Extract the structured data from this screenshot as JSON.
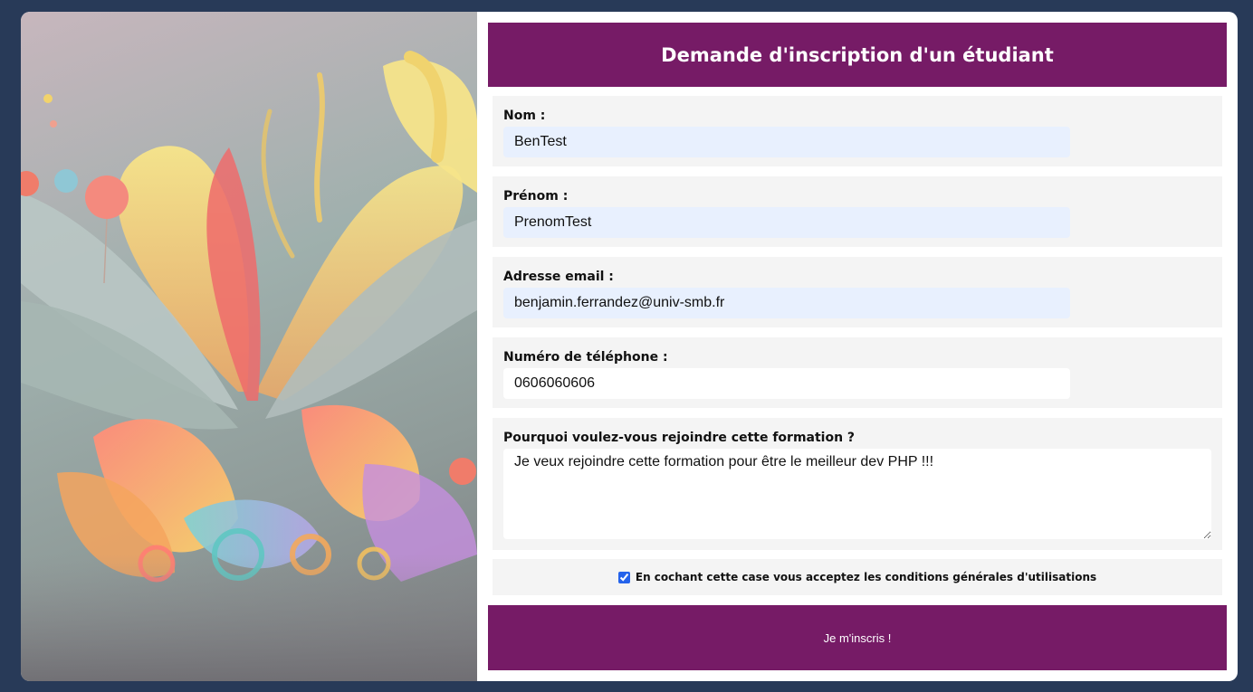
{
  "form": {
    "title": "Demande d'inscription d'un étudiant",
    "fields": [
      {
        "label": "Nom :",
        "value": "BenTest"
      },
      {
        "label": "Prénom :",
        "value": "PrenomTest"
      },
      {
        "label": "Adresse email :",
        "value": "benjamin.ferrandez@univ-smb.fr"
      },
      {
        "label": "Numéro de téléphone :",
        "value": "0606060606"
      },
      {
        "label": "Pourquoi voulez-vous rejoindre cette formation ?",
        "value": "Je veux rejoindre cette formation pour être le meilleur dev PHP !!!"
      }
    ],
    "terms": {
      "label": "En cochant cette case vous acceptez les conditions générales d'utilisations",
      "checked": true
    },
    "submit_label": "Je m'inscris !"
  },
  "colors": {
    "background": "#283a58",
    "accent": "#761b66",
    "field_bg": "#f4f4f4",
    "autofill_bg": "#e8f0fe"
  }
}
